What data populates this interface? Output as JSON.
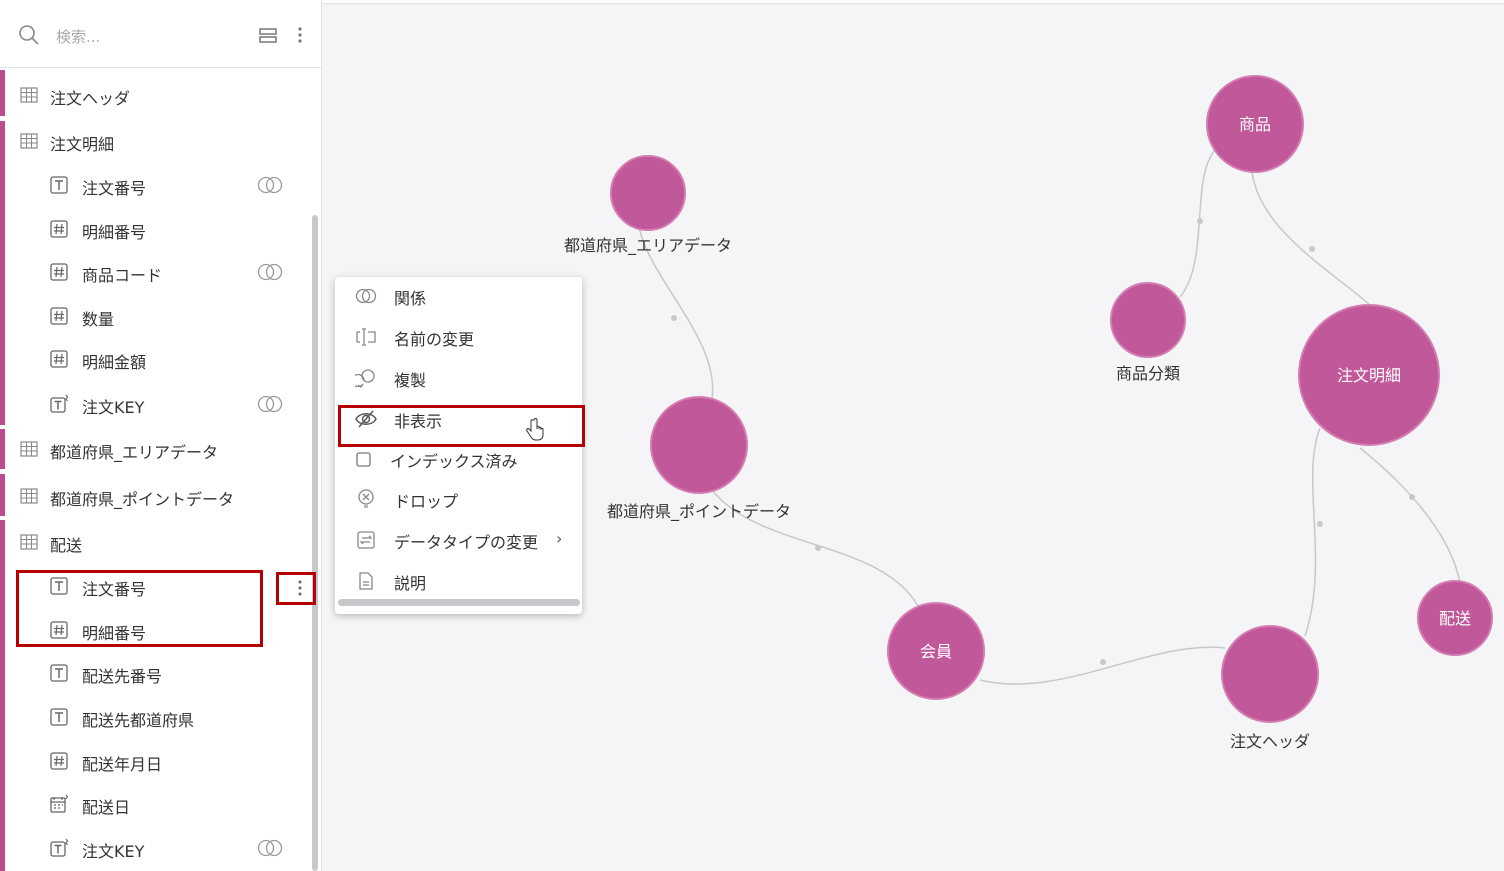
{
  "search": {
    "placeholder": "検索..."
  },
  "sidebar": {
    "rows": [
      {
        "type": "table",
        "label": "注文ヘッダ"
      },
      {
        "type": "table",
        "label": "注文明細"
      },
      {
        "type": "text",
        "label": "注文番号",
        "relation": true
      },
      {
        "type": "number",
        "label": "明細番号",
        "relation": false
      },
      {
        "type": "number",
        "label": "商品コード",
        "relation": true
      },
      {
        "type": "number",
        "label": "数量",
        "relation": false
      },
      {
        "type": "number",
        "label": "明細金額",
        "relation": false
      },
      {
        "type": "text-key",
        "label": "注文KEY",
        "relation": true
      },
      {
        "type": "table",
        "label": "都道府県_エリアデータ"
      },
      {
        "type": "table",
        "label": "都道府県_ポイントデータ"
      },
      {
        "type": "table",
        "label": "配送"
      },
      {
        "type": "text",
        "label": "注文番号",
        "relation": false
      },
      {
        "type": "number",
        "label": "明細番号",
        "relation": false
      },
      {
        "type": "text",
        "label": "配送先番号",
        "relation": false
      },
      {
        "type": "text",
        "label": "配送先都道府県",
        "relation": false
      },
      {
        "type": "number",
        "label": "配送年月日",
        "relation": false
      },
      {
        "type": "date-key",
        "label": "配送日",
        "relation": false
      },
      {
        "type": "text-key",
        "label": "注文KEY",
        "relation": true
      }
    ]
  },
  "menu": {
    "items": [
      {
        "icon": "relation-icon",
        "label": "関係"
      },
      {
        "icon": "rename-icon",
        "label": "名前の変更"
      },
      {
        "icon": "duplicate-icon",
        "label": "複製"
      },
      {
        "icon": "eye-hidden-icon",
        "label": "非表示"
      },
      {
        "icon": "checkbox-icon",
        "label": "インデックス済み"
      },
      {
        "icon": "drop-icon",
        "label": "ドロップ"
      },
      {
        "icon": "datatype-icon",
        "label": "データタイプの変更",
        "submenu": true
      },
      {
        "icon": "document-icon",
        "label": "説明"
      }
    ]
  },
  "graph": {
    "node_color": "#c0589a",
    "nodes": [
      {
        "id": "shohin",
        "label": "商品",
        "label_inside": true
      },
      {
        "id": "shohin_bunrui",
        "label": "商品分類",
        "label_inside": false
      },
      {
        "id": "chumon_meisai",
        "label": "注文明細",
        "label_inside": true
      },
      {
        "id": "haiso",
        "label": "配送",
        "label_inside": true
      },
      {
        "id": "chumon_header",
        "label": "注文ヘッダ",
        "label_inside": false
      },
      {
        "id": "kaiin",
        "label": "会員",
        "label_inside": true
      },
      {
        "id": "area",
        "label": "都道府県_エリアデータ",
        "label_inside": false
      },
      {
        "id": "point",
        "label": "都道府県_ポイントデータ",
        "label_inside": false
      }
    ]
  },
  "colors": {
    "accent": "#bd4b8f",
    "highlight": "#b40000",
    "node": "#c0589a",
    "edge": "#c8c8cc"
  }
}
